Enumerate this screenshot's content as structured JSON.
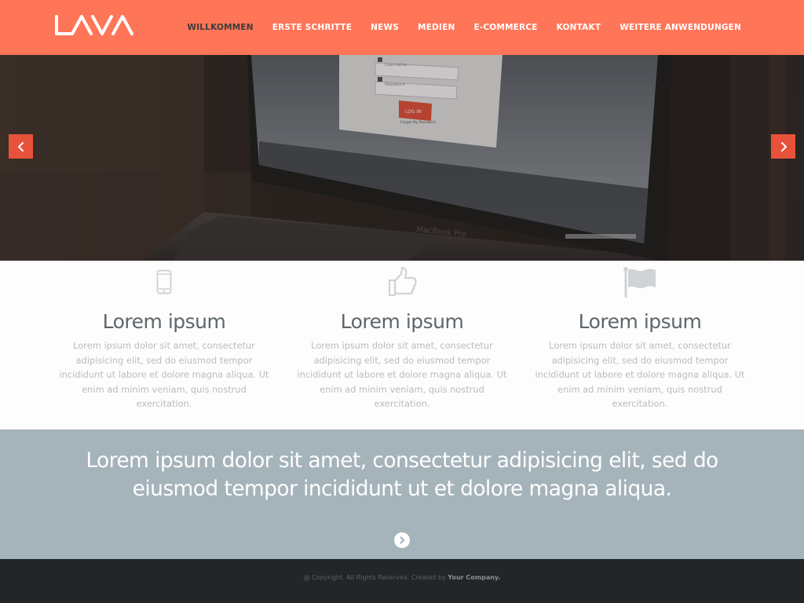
{
  "header": {
    "logo_text": "LAVA",
    "nav": [
      {
        "label": "WILLKOMMEN",
        "active": true
      },
      {
        "label": "ERSTE SCHRITTE",
        "active": false
      },
      {
        "label": "NEWS",
        "active": false
      },
      {
        "label": "MEDIEN",
        "active": false
      },
      {
        "label": "E-COMMERCE",
        "active": false
      },
      {
        "label": "KONTAKT",
        "active": false
      },
      {
        "label": "WEITERE ANWENDUNGEN",
        "active": false
      }
    ]
  },
  "hero": {
    "screen": {
      "username_placeholder": "Username",
      "password_placeholder": "Password",
      "login_button": "LOG IN",
      "forgot_link": "Forgot My Password",
      "laptop_brand": "MacBook Pro"
    },
    "prev_icon": "chevron-left-icon",
    "next_icon": "chevron-right-icon"
  },
  "features": [
    {
      "icon": "mobile-phone-icon",
      "title": "Lorem ipsum",
      "text": "Lorem ipsum dolor sit amet, consectetur adipisicing elit, sed do eiusmod tempor incididunt ut labore et dolore magna aliqua. Ut enim ad minim veniam, quis nostrud exercitation."
    },
    {
      "icon": "thumbs-up-icon",
      "title": "Lorem ipsum",
      "text": "Lorem ipsum dolor sit amet, consectetur adipisicing elit, sed do eiusmod tempor incididunt ut labore et dolore magna aliqua. Ut enim ad minim veniam, quis nostrud exercitation."
    },
    {
      "icon": "flag-icon",
      "title": "Lorem ipsum",
      "text": "Lorem ipsum dolor sit amet, consectetur adipisicing elit, sed do eiusmod tempor incididunt ut labore et dolore magna aliqua. Ut enim ad minim veniam, quis nostrud exercitation."
    }
  ],
  "quote": {
    "text": "Lorem ipsum dolor sit amet, consectetur adipisicing elit, sed do eiusmod tempor incididunt ut et dolore magna aliqua.",
    "scroll_icon": "circle-chevron-right-icon"
  },
  "footer": {
    "copyright": "@ Copyright. All Rights Reserved. Created by",
    "company": "Your Company."
  },
  "colors": {
    "accent": "#ff7557",
    "slider_arrow": "#e8523a",
    "quote_band": "#a5b3ba",
    "footer": "#232629"
  }
}
